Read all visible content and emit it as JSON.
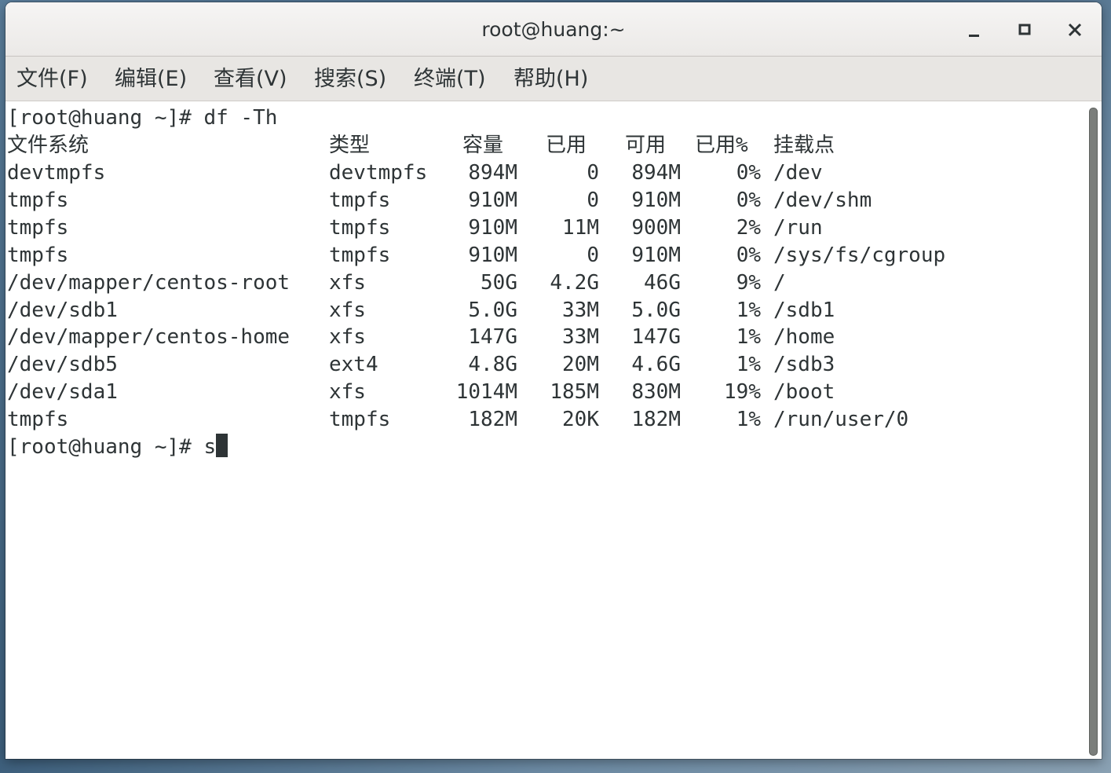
{
  "window": {
    "title": "root@huang:~"
  },
  "window_controls": {
    "minimize_icon": "minimize-icon",
    "maximize_icon": "maximize-icon",
    "close_icon": "close-icon"
  },
  "menu": {
    "items": [
      {
        "label": "文件(F)"
      },
      {
        "label": "编辑(E)"
      },
      {
        "label": "查看(V)"
      },
      {
        "label": "搜索(S)"
      },
      {
        "label": "终端(T)"
      },
      {
        "label": "帮助(H)"
      }
    ]
  },
  "terminal": {
    "command_prompt": "[root@huang ~]# df -Th",
    "header": {
      "filesystem": "文件系统",
      "type": "类型",
      "size": "容量",
      "used": "已用",
      "avail": "可用",
      "use_pct": "已用%",
      "mount": "挂载点"
    },
    "rows": [
      {
        "filesystem": "devtmpfs",
        "type": "devtmpfs",
        "size": "894M",
        "used": "0",
        "avail": "894M",
        "use_pct": "0%",
        "mount": "/dev"
      },
      {
        "filesystem": "tmpfs",
        "type": "tmpfs",
        "size": "910M",
        "used": "0",
        "avail": "910M",
        "use_pct": "0%",
        "mount": "/dev/shm"
      },
      {
        "filesystem": "tmpfs",
        "type": "tmpfs",
        "size": "910M",
        "used": "11M",
        "avail": "900M",
        "use_pct": "2%",
        "mount": "/run"
      },
      {
        "filesystem": "tmpfs",
        "type": "tmpfs",
        "size": "910M",
        "used": "0",
        "avail": "910M",
        "use_pct": "0%",
        "mount": "/sys/fs/cgroup"
      },
      {
        "filesystem": "/dev/mapper/centos-root",
        "type": "xfs",
        "size": "50G",
        "used": "4.2G",
        "avail": "46G",
        "use_pct": "9%",
        "mount": "/"
      },
      {
        "filesystem": "/dev/sdb1",
        "type": "xfs",
        "size": "5.0G",
        "used": "33M",
        "avail": "5.0G",
        "use_pct": "1%",
        "mount": "/sdb1"
      },
      {
        "filesystem": "/dev/mapper/centos-home",
        "type": "xfs",
        "size": "147G",
        "used": "33M",
        "avail": "147G",
        "use_pct": "1%",
        "mount": "/home"
      },
      {
        "filesystem": "/dev/sdb5",
        "type": "ext4",
        "size": "4.8G",
        "used": "20M",
        "avail": "4.6G",
        "use_pct": "1%",
        "mount": "/sdb3"
      },
      {
        "filesystem": "/dev/sda1",
        "type": "xfs",
        "size": "1014M",
        "used": "185M",
        "avail": "830M",
        "use_pct": "19%",
        "mount": "/boot"
      },
      {
        "filesystem": "tmpfs",
        "type": "tmpfs",
        "size": "182M",
        "used": "20K",
        "avail": "182M",
        "use_pct": "1%",
        "mount": "/run/user/0"
      }
    ],
    "current_prompt": "[root@huang ~]# ",
    "current_input": "s"
  },
  "colors": {
    "text": "#2e3436",
    "background": "#ffffff",
    "titlebar": "#f6f5f4",
    "menubar": "#e8e6e3"
  }
}
